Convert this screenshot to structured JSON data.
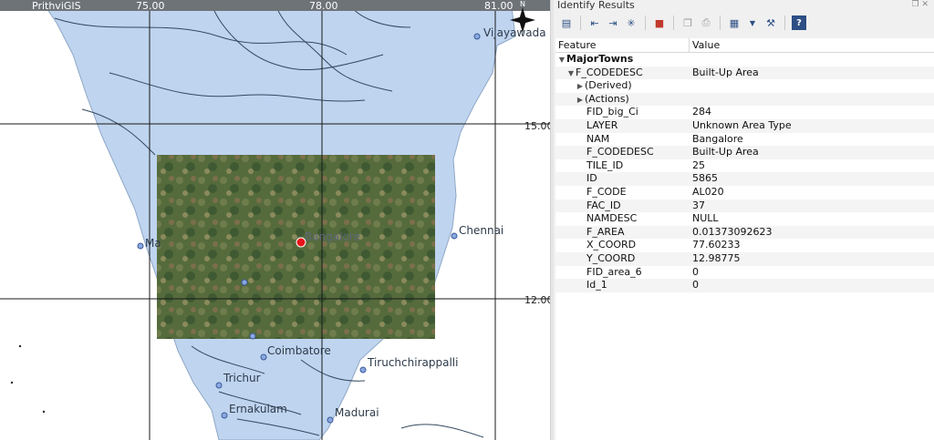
{
  "map": {
    "brand_label": "PrithviGIS",
    "top_labels": [
      "75.00",
      "78.00",
      "81.00"
    ],
    "right_labels": [
      "15.00",
      "12.00"
    ],
    "cities": [
      "Vijayawada",
      "Chennai",
      "Bangalore",
      "Coimbatore",
      "Tiruchchirappalli",
      "Trichur",
      "Ernakulam",
      "Madurai",
      "Ma"
    ],
    "north_arrow_label": "N",
    "colors": {
      "land": "#bfd4ef",
      "sea": "#ffffff",
      "grid": "#1a1a1a",
      "river": "#34495e",
      "boundary": "#3a3a3a",
      "selected": "#e8141a"
    }
  },
  "panel": {
    "title": "Identify Results",
    "window_controls": "❐ ✕",
    "toolbar_icons": [
      "expand-tree-icon",
      "collapse-icon",
      "expand-icon",
      "expand-new-icon",
      "clear-results-icon",
      "copy-icon",
      "print-icon",
      "select-mode-icon",
      "dropdown-arrow-icon",
      "settings-icon",
      "help-icon"
    ],
    "columns": [
      "Feature",
      "Value"
    ],
    "rows": [
      {
        "feature": "MajorTowns",
        "value": "",
        "depth": 0,
        "arrow": "▼",
        "bold": true
      },
      {
        "feature": "F_CODEDESC",
        "value": "Built-Up Area",
        "depth": 1,
        "arrow": "▼"
      },
      {
        "feature": "(Derived)",
        "value": "",
        "depth": 2,
        "arrow": "▶"
      },
      {
        "feature": "(Actions)",
        "value": "",
        "depth": 2,
        "arrow": "▶"
      },
      {
        "feature": "FID_big_Ci",
        "value": "284",
        "depth": 3,
        "arrow": ""
      },
      {
        "feature": "LAYER",
        "value": "Unknown Area Type",
        "depth": 3,
        "arrow": ""
      },
      {
        "feature": "NAM",
        "value": "Bangalore",
        "depth": 3,
        "arrow": ""
      },
      {
        "feature": "F_CODEDESC",
        "value": "Built-Up Area",
        "depth": 3,
        "arrow": ""
      },
      {
        "feature": "TILE_ID",
        "value": "25",
        "depth": 3,
        "arrow": ""
      },
      {
        "feature": "ID",
        "value": "5865",
        "depth": 3,
        "arrow": ""
      },
      {
        "feature": "F_CODE",
        "value": "AL020",
        "depth": 3,
        "arrow": ""
      },
      {
        "feature": "FAC_ID",
        "value": "37",
        "depth": 3,
        "arrow": ""
      },
      {
        "feature": "NAMDESC",
        "value": "NULL",
        "depth": 3,
        "arrow": ""
      },
      {
        "feature": "F_AREA",
        "value": "0.01373092623",
        "depth": 3,
        "arrow": ""
      },
      {
        "feature": "X_COORD",
        "value": "77.60233",
        "depth": 3,
        "arrow": ""
      },
      {
        "feature": "Y_COORD",
        "value": "12.98775",
        "depth": 3,
        "arrow": ""
      },
      {
        "feature": "FID_area_6",
        "value": "0",
        "depth": 3,
        "arrow": ""
      },
      {
        "feature": "Id_1",
        "value": "0",
        "depth": 3,
        "arrow": ""
      }
    ]
  }
}
